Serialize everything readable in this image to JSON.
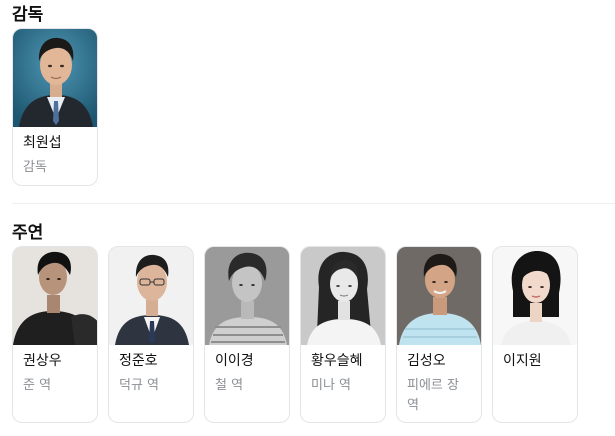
{
  "sections": {
    "director_title": "감독",
    "cast_title": "주연"
  },
  "director": {
    "name": "최원섭",
    "role": "감독"
  },
  "cast": [
    {
      "name": "권상우",
      "role": "준 역"
    },
    {
      "name": "정준호",
      "role": "덕규 역"
    },
    {
      "name": "이이경",
      "role": "철 역"
    },
    {
      "name": "황우슬혜",
      "role": "미나 역"
    },
    {
      "name": "김성오",
      "role": "피에르 장 역"
    },
    {
      "name": "이지원",
      "role": ""
    }
  ],
  "colors": {
    "card_border": "#e3e5e8",
    "role_text": "#8b8f94",
    "director_photo_bg": "#2b6b86"
  }
}
